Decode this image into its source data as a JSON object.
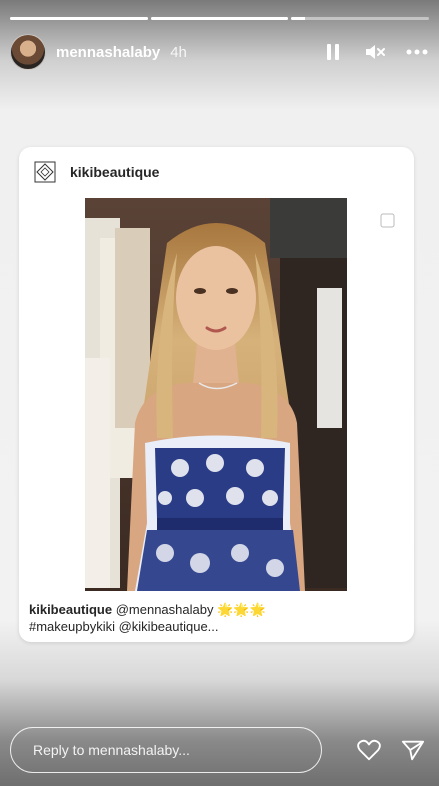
{
  "story": {
    "progress": [
      1,
      1,
      0.1
    ],
    "username": "mennashalaby",
    "time": "4h"
  },
  "post": {
    "author": "kikibeautique",
    "caption_user": "kikibeautique",
    "caption_mention": "@mennashalaby",
    "caption_stars": "🌟🌟🌟",
    "caption_line2": "#makeupbykiki @kikibeautique..."
  },
  "footer": {
    "reply_placeholder": "Reply to mennashalaby..."
  },
  "icons": {
    "pause": "pause-icon",
    "mute": "mute-icon",
    "more": "more-icon",
    "heart": "heart-icon",
    "send": "send-icon"
  }
}
